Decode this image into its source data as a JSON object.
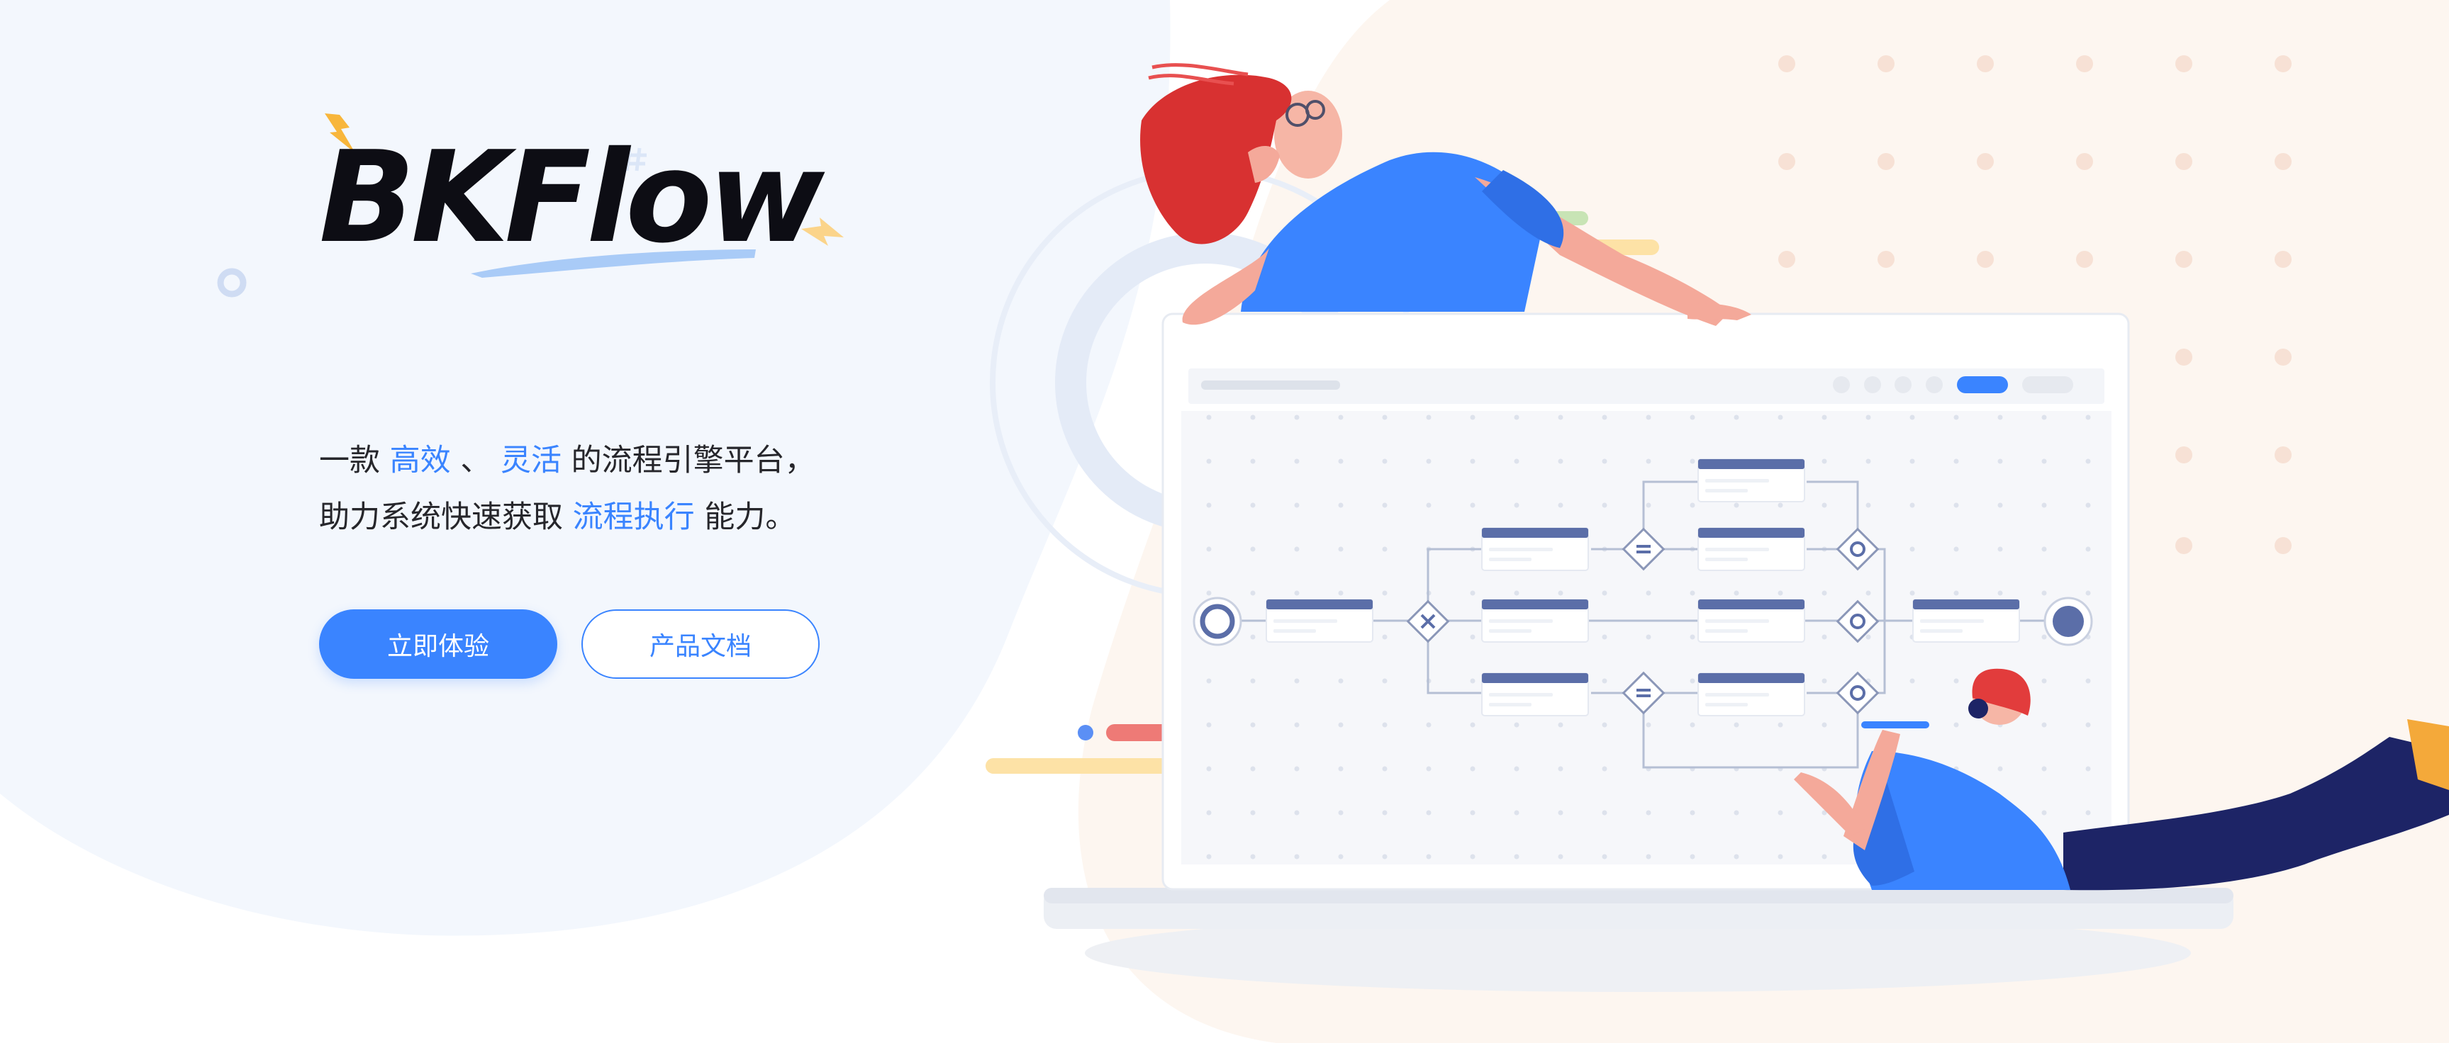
{
  "brand": {
    "logo_text": "BKFlow"
  },
  "hero": {
    "tagline_parts": [
      {
        "text": "一款 ",
        "highlight": false
      },
      {
        "text": "高效",
        "highlight": true
      },
      {
        "text": " 、 ",
        "highlight": false
      },
      {
        "text": "灵活",
        "highlight": true
      },
      {
        "text": " 的流程引擎平台，助力系统快速获取 ",
        "highlight": false
      },
      {
        "text": "流程执行",
        "highlight": true
      },
      {
        "text": " 能力。",
        "highlight": false
      }
    ],
    "primary_button": "立即体验",
    "secondary_button": "产品文档"
  },
  "colors": {
    "accent": "#3a84ff",
    "text": "#26262b",
    "background_blob": "#f3f7fd",
    "peach_blob": "#fdf5ef",
    "node_header": "#5b6ea8"
  }
}
